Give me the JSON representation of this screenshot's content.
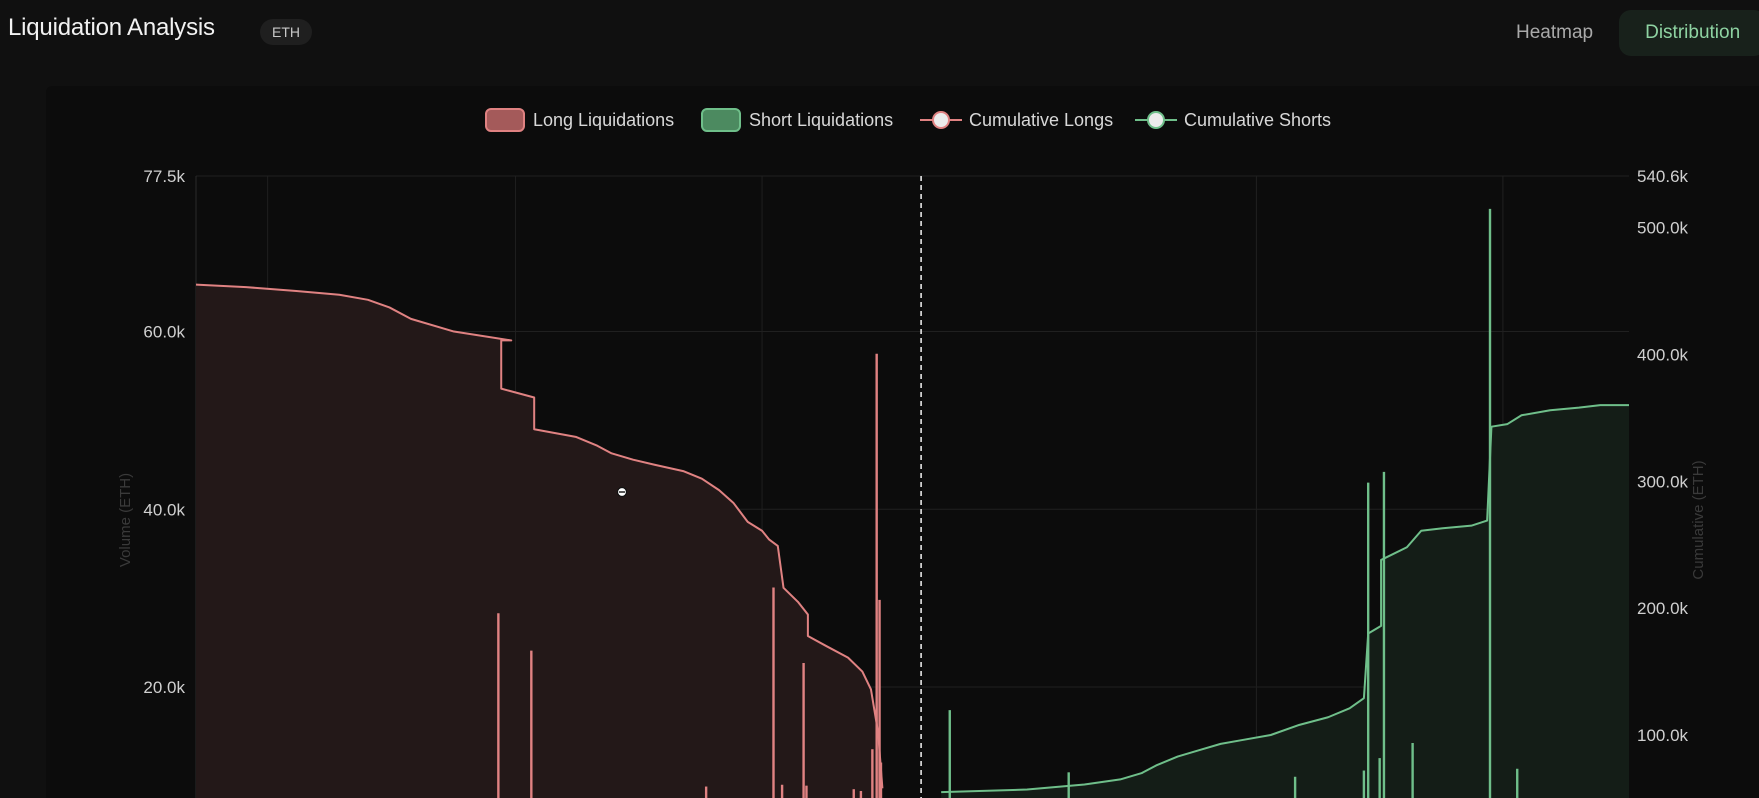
{
  "header": {
    "title": "Liquidation Analysis",
    "badge": "ETH",
    "tabs": [
      {
        "label": "Heatmap",
        "active": false
      },
      {
        "label": "Distribution",
        "active": true
      }
    ]
  },
  "colors": {
    "long": "#e08282",
    "long_fill": "#231818",
    "short": "#6fbf8a",
    "short_fill": "#141d17",
    "grid": "#202020",
    "background": "#0c0c0c"
  },
  "chart_data": {
    "type": "bar",
    "legend": [
      {
        "label": "Long Liquidations",
        "kind": "box",
        "color": "#e08282"
      },
      {
        "label": "Short Liquidations",
        "kind": "box",
        "color": "#6fbf8a"
      },
      {
        "label": "Cumulative Longs",
        "kind": "line",
        "color": "#e08282"
      },
      {
        "label": "Cumulative Shorts",
        "kind": "line",
        "color": "#6fbf8a"
      }
    ],
    "ylabel": "Volume (ETH)",
    "y2label": "Cumulative (ETH)",
    "y_ticks": [
      "77.5k",
      "60.0k",
      "40.0k",
      "20.0k"
    ],
    "y_tick_values": [
      77.5,
      60,
      40,
      20
    ],
    "y2_ticks": [
      "540.6k",
      "500.0k",
      "400.0k",
      "300.0k",
      "200.0k",
      "100.0k"
    ],
    "y2_tick_values": [
      540.6,
      500,
      400,
      300,
      200,
      100
    ],
    "ylim_visible": [
      8,
      77.5
    ],
    "y2lim_visible": [
      58,
      540.6
    ],
    "x_range": [
      0,
      100
    ],
    "current_price_x": 50.6,
    "long_bars": [
      {
        "x": 21.1,
        "value": 28.3
      },
      {
        "x": 23.4,
        "value": 24.1
      },
      {
        "x": 35.6,
        "value": 8.8
      },
      {
        "x": 40.3,
        "value": 31.2
      },
      {
        "x": 40.9,
        "value": 9.0
      },
      {
        "x": 42.4,
        "value": 22.7
      },
      {
        "x": 42.6,
        "value": 8.9
      },
      {
        "x": 45.9,
        "value": 8.5
      },
      {
        "x": 46.4,
        "value": 8.3
      },
      {
        "x": 47.2,
        "value": 13.0
      },
      {
        "x": 47.5,
        "value": 57.5
      },
      {
        "x": 47.7,
        "value": 29.8
      },
      {
        "x": 47.8,
        "value": 11.5
      }
    ],
    "short_bars": [
      {
        "x": 52.6,
        "value": 17.4
      },
      {
        "x": 60.9,
        "value": 10.4
      },
      {
        "x": 76.7,
        "value": 9.9
      },
      {
        "x": 81.5,
        "value": 10.6
      },
      {
        "x": 81.8,
        "value": 43.0
      },
      {
        "x": 82.6,
        "value": 12.0
      },
      {
        "x": 82.9,
        "value": 44.2
      },
      {
        "x": 84.9,
        "value": 13.7
      },
      {
        "x": 90.3,
        "value": 73.8
      },
      {
        "x": 92.2,
        "value": 10.8
      }
    ],
    "cumulative_longs": [
      [
        0,
        455
      ],
      [
        3.5,
        453
      ],
      [
        7,
        450
      ],
      [
        10,
        447
      ],
      [
        12,
        443
      ],
      [
        13.5,
        437
      ],
      [
        15,
        428
      ],
      [
        18,
        418
      ],
      [
        22,
        411
      ],
      [
        21.3,
        411
      ],
      [
        21.3,
        373
      ],
      [
        23.6,
        366
      ],
      [
        23.6,
        341
      ],
      [
        26.5,
        335
      ],
      [
        28,
        328
      ],
      [
        29,
        322
      ],
      [
        30.5,
        317
      ],
      [
        32,
        313
      ],
      [
        34,
        308
      ],
      [
        35.3,
        302
      ],
      [
        36.5,
        293
      ],
      [
        37.5,
        283
      ],
      [
        38.5,
        268
      ],
      [
        39.5,
        261
      ],
      [
        40,
        254
      ],
      [
        40.6,
        249
      ],
      [
        41,
        216
      ],
      [
        42,
        205
      ],
      [
        42.7,
        195
      ],
      [
        42.7,
        178
      ],
      [
        44,
        170
      ],
      [
        45.5,
        161
      ],
      [
        46.5,
        150
      ],
      [
        47.1,
        136
      ],
      [
        47.6,
        102
      ],
      [
        47.9,
        58
      ]
    ],
    "cumulative_shorts": [
      [
        52,
        55
      ],
      [
        58,
        57
      ],
      [
        62,
        61
      ],
      [
        64.5,
        65
      ],
      [
        66,
        70
      ],
      [
        67,
        76
      ],
      [
        68.5,
        83
      ],
      [
        70,
        88
      ],
      [
        71.5,
        93
      ],
      [
        73,
        96
      ],
      [
        75,
        100
      ],
      [
        77,
        108
      ],
      [
        79,
        114
      ],
      [
        80.5,
        121
      ],
      [
        81.5,
        129
      ],
      [
        81.8,
        180
      ],
      [
        82.7,
        186
      ],
      [
        82.7,
        238
      ],
      [
        84.5,
        248
      ],
      [
        85.5,
        261
      ],
      [
        87,
        263
      ],
      [
        89,
        265
      ],
      [
        90.1,
        269
      ],
      [
        90.4,
        343
      ],
      [
        91.5,
        345
      ],
      [
        92.5,
        352
      ],
      [
        94.5,
        356
      ],
      [
        96.5,
        358
      ],
      [
        98,
        360
      ],
      [
        100,
        360
      ]
    ]
  }
}
